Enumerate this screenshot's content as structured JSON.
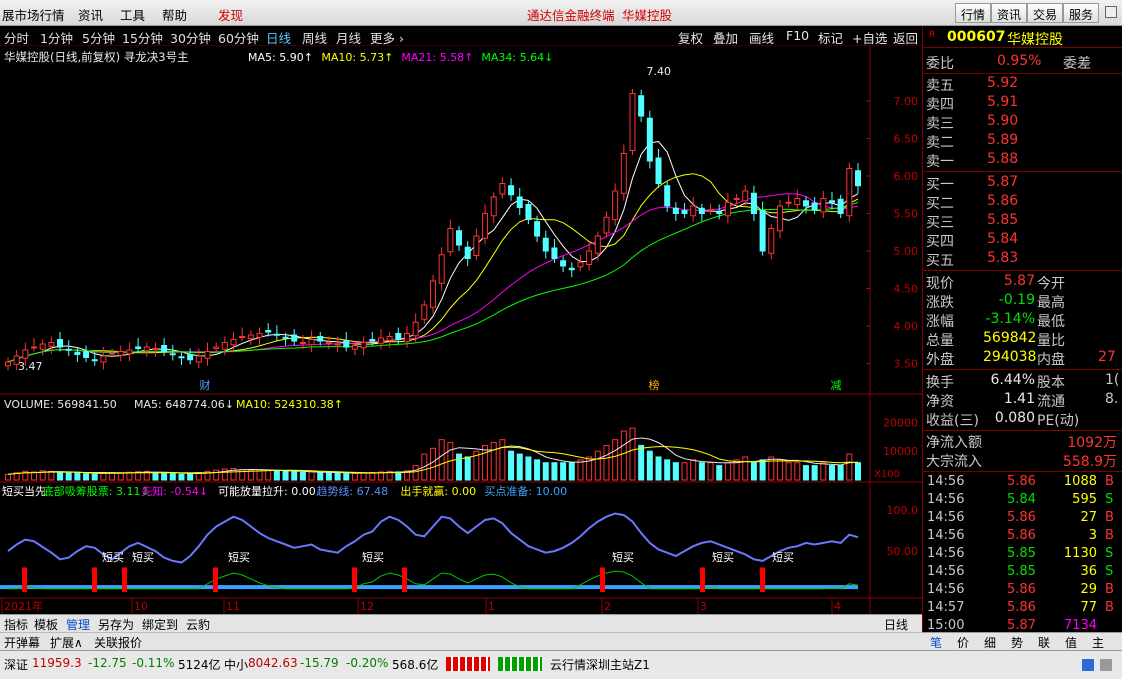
{
  "menu": {
    "app": "展市场行情",
    "news": "资讯",
    "tools": "工具",
    "help": "帮助",
    "discover": "发现",
    "center1": "通达信金融终端",
    "center2": "华媒控股",
    "quote_btn": "行情",
    "info_btn": "资讯",
    "trade_btn": "交易",
    "service_btn": "服务"
  },
  "periods": [
    "分时",
    "1分钟",
    "5分钟",
    "15分钟",
    "30分钟",
    "60分钟",
    "日线",
    "周线",
    "月线",
    "更多 ›"
  ],
  "active_period": "日线",
  "toolbar": [
    "复权",
    "叠加",
    "画线",
    "F10",
    "标记",
    "+自选",
    "返回"
  ],
  "chart_data": {
    "type": "candlestick",
    "title": "华媒控股(日线,前复权) 寻龙决3号主",
    "ylim": [
      3.2,
      7.6
    ],
    "price_ticks": [
      "7.00",
      "6.50",
      "6.00",
      "5.50",
      "5.00",
      "4.50",
      "4.00",
      "3.50"
    ],
    "ma_labels": [
      {
        "t": "MA5: 5.90",
        "c": "#ffffff",
        "a": "↑"
      },
      {
        "t": "MA10: 5.73",
        "c": "#ffff00",
        "a": "↑"
      },
      {
        "t": "MA21: 5.58",
        "c": "#ff00ff",
        "a": "↑"
      },
      {
        "t": "MA34: 5.64",
        "c": "#00ff00",
        "a": "↓"
      }
    ],
    "high_label": "7.40",
    "low_label": "3.47",
    "markers": [
      "财",
      "榜",
      "减"
    ],
    "volume_title": "VOLUME: 569841.50",
    "vol_ma5": "MA5: 648774.06",
    "vol_ma10": "MA10: 524310.38",
    "vol_ticks": [
      "20000",
      "10000"
    ],
    "vol_unit": "X100",
    "ind_labels": [
      {
        "t": "短买当先",
        "c": "#ffffff"
      },
      {
        "t": "底部吸筹股票: 3.11",
        "c": "#00ff00",
        "a": "↓"
      },
      {
        "t": "先知: -0.54",
        "c": "#ff00ff",
        "a": "↓"
      },
      {
        "t": "可能放量拉升: 0.00",
        "c": "#ffffff"
      },
      {
        "t": "趋势线: 67.48",
        "c": "#5a8cff"
      },
      {
        "t": "出手就赢: 0.00",
        "c": "#ffff00"
      },
      {
        "t": "买点准备: 10.00",
        "c": "#3aa0ff"
      }
    ],
    "ind_ticks": [
      "100.0",
      "50.00"
    ],
    "short_buy": "短买",
    "date_labels": [
      "2021年",
      "10",
      "11",
      "12",
      "1",
      "2",
      "3",
      "4"
    ],
    "period_label": "日线",
    "closes": [
      3.52,
      3.6,
      3.68,
      3.72,
      3.76,
      3.78,
      3.72,
      3.68,
      3.62,
      3.58,
      3.55,
      3.6,
      3.64,
      3.66,
      3.68,
      3.7,
      3.72,
      3.7,
      3.66,
      3.62,
      3.58,
      3.55,
      3.6,
      3.66,
      3.72,
      3.78,
      3.82,
      3.86,
      3.88,
      3.9,
      3.92,
      3.88,
      3.84,
      3.8,
      3.78,
      3.82,
      3.8,
      3.78,
      3.76,
      3.72,
      3.74,
      3.78,
      3.8,
      3.84,
      3.86,
      3.82,
      3.9,
      4.05,
      4.28,
      4.6,
      4.95,
      5.3,
      5.08,
      4.9,
      5.2,
      5.5,
      5.72,
      5.9,
      5.75,
      5.58,
      5.42,
      5.2,
      5.0,
      4.9,
      4.8,
      4.75,
      4.85,
      5.0,
      5.2,
      5.45,
      5.8,
      6.3,
      7.1,
      6.8,
      6.2,
      5.9,
      5.6,
      5.5,
      5.5,
      5.6,
      5.5,
      5.55,
      5.5,
      5.65,
      5.7,
      5.8,
      5.5,
      5.0,
      5.3,
      5.6,
      5.65,
      5.7,
      5.6,
      5.55,
      5.7,
      5.65,
      5.5,
      6.1,
      5.87
    ],
    "vols": [
      2,
      2.5,
      3,
      2.8,
      3.2,
      3,
      2.6,
      2.4,
      2.5,
      2.2,
      2,
      2.4,
      2.6,
      2.5,
      2.7,
      2.9,
      3,
      2.6,
      2.4,
      2.2,
      2,
      2.1,
      2.6,
      3,
      3.4,
      3.8,
      4,
      3.6,
      3.4,
      3.2,
      3.4,
      3.2,
      3,
      2.8,
      2.6,
      2.8,
      2.6,
      2.5,
      2.4,
      2.2,
      2.3,
      2.5,
      2.6,
      2.8,
      3,
      2.8,
      3.2,
      5,
      9,
      11,
      14,
      13,
      9,
      8,
      10,
      12,
      13,
      14,
      10,
      9,
      8,
      7,
      6,
      6,
      6,
      6,
      7,
      8,
      10,
      12,
      14,
      17,
      18,
      12,
      10,
      8,
      7,
      6,
      6,
      7,
      6,
      6,
      5,
      6,
      7,
      8,
      6,
      7,
      8,
      7,
      6,
      6,
      5,
      5,
      6,
      5,
      5,
      9,
      6
    ],
    "trend": [
      50,
      58,
      64,
      62,
      55,
      48,
      40,
      42,
      50,
      56,
      54,
      46,
      40,
      48,
      56,
      60,
      55,
      50,
      42,
      38,
      36,
      44,
      56,
      70,
      80,
      86,
      92,
      88,
      80,
      72,
      66,
      62,
      58,
      54,
      56,
      58,
      52,
      50,
      48,
      56,
      62,
      70,
      74,
      86,
      92,
      88,
      80,
      70,
      68,
      80,
      92,
      90,
      80,
      72,
      80,
      88,
      90,
      84,
      72,
      64,
      56,
      52,
      48,
      50,
      54,
      60,
      68,
      78,
      86,
      92,
      96,
      94,
      86,
      72,
      60,
      52,
      48,
      44,
      50,
      56,
      60,
      62,
      58,
      54,
      50,
      46,
      40,
      38,
      44,
      50,
      54,
      56,
      60,
      58,
      60,
      62,
      60,
      70,
      67
    ]
  },
  "quote": {
    "code": "000607",
    "name": "华媒控股",
    "wb_label": "委比",
    "wb_val": "0.95%",
    "wc_label": "委差",
    "asks": [
      {
        "l": "卖五",
        "p": "5.92"
      },
      {
        "l": "卖四",
        "p": "5.91"
      },
      {
        "l": "卖三",
        "p": "5.90"
      },
      {
        "l": "卖二",
        "p": "5.89"
      },
      {
        "l": "卖一",
        "p": "5.88"
      }
    ],
    "bids": [
      {
        "l": "买一",
        "p": "5.87"
      },
      {
        "l": "买二",
        "p": "5.86"
      },
      {
        "l": "买三",
        "p": "5.85"
      },
      {
        "l": "买四",
        "p": "5.84"
      },
      {
        "l": "买五",
        "p": "5.83"
      }
    ],
    "stats": [
      {
        "a": "现价",
        "av": "5.87",
        "b": "今开",
        "bv": ""
      },
      {
        "a": "涨跌",
        "av": "-0.19",
        "b": "最高",
        "bv": ""
      },
      {
        "a": "涨幅",
        "av": "-3.14%",
        "b": "最低",
        "bv": ""
      },
      {
        "a": "总量",
        "av": "569842",
        "b": "量比",
        "bv": ""
      },
      {
        "a": "外盘",
        "av": "294038",
        "b": "内盘",
        "bv": "27"
      }
    ],
    "stats2": [
      {
        "a": "换手",
        "av": "6.44%",
        "b": "股本",
        "bv": "1("
      },
      {
        "a": "净资",
        "av": "1.41",
        "b": "流通",
        "bv": "8."
      },
      {
        "a": "收益(三)",
        "av": "0.080",
        "b": "PE(动)",
        "bv": ""
      }
    ],
    "flow": [
      {
        "a": "净流入额",
        "av": "1092万"
      },
      {
        "a": "大宗流入",
        "av": "558.9万"
      }
    ],
    "ticks": [
      {
        "t": "14:56",
        "p": "5.86",
        "v": "1088",
        "s": "B"
      },
      {
        "t": "14:56",
        "p": "5.84",
        "v": "595",
        "s": "S"
      },
      {
        "t": "14:56",
        "p": "5.86",
        "v": "27",
        "s": "B"
      },
      {
        "t": "14:56",
        "p": "5.86",
        "v": "3",
        "s": "B"
      },
      {
        "t": "14:56",
        "p": "5.85",
        "v": "1130",
        "s": "S"
      },
      {
        "t": "14:56",
        "p": "5.85",
        "v": "36",
        "s": "S"
      },
      {
        "t": "14:56",
        "p": "5.86",
        "v": "29",
        "s": "B"
      },
      {
        "t": "14:57",
        "p": "5.86",
        "v": "77",
        "s": "B"
      },
      {
        "t": "15:00",
        "p": "5.87",
        "v": "7134",
        "s": ""
      }
    ],
    "tabs": [
      "笔",
      "价",
      "细",
      "势",
      "联",
      "值",
      "主"
    ]
  },
  "bottom": {
    "tabs": [
      "指标",
      "模板",
      "管理",
      "另存为",
      "绑定到",
      "云豹"
    ],
    "tabs2": [
      "开弹幕",
      "扩展∧",
      "关联报价"
    ],
    "period": "日线"
  },
  "status": {
    "sz_label": "深证",
    "sz_val": "11959.3",
    "sz_chg": "-12.75",
    "sz_pct": "-0.11%",
    "sz_amt": "5124亿",
    "zx_label": "中小",
    "zx_val": "8042.63",
    "zx_chg": "-15.79",
    "zx_pct": "-0.20%",
    "zx_amt": "568.6亿",
    "server": "云行情深圳主站Z1"
  }
}
